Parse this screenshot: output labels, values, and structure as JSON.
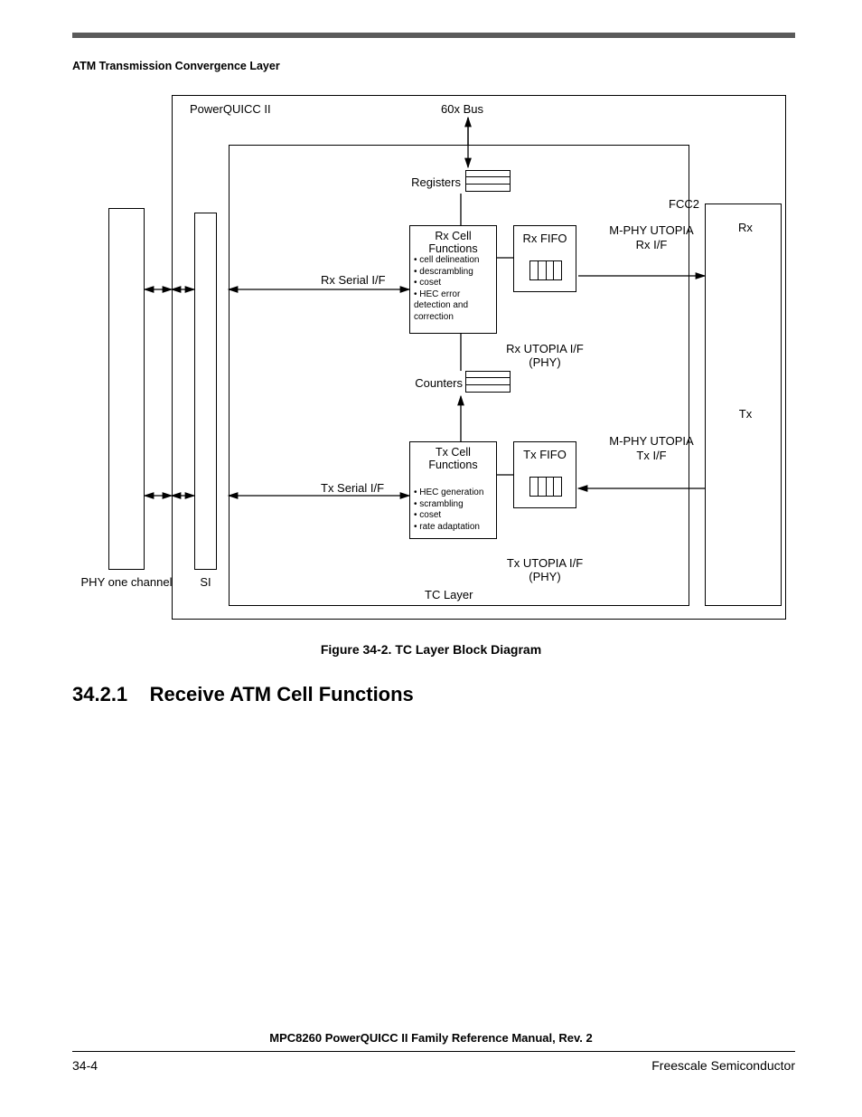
{
  "header": {
    "running_title": "ATM Transmission Convergence Layer"
  },
  "diagram": {
    "outer_label": "PowerQUICC II",
    "bus_label": "60x Bus",
    "registers_label": "Registers",
    "counters_label": "Counters",
    "rx_cell_title": "Rx Cell Functions",
    "rx_cell_bullets": {
      "b1": "• cell delineation",
      "b2": "• descrambling",
      "b3": "• coset",
      "b4": "• HEC error detection and correction"
    },
    "tx_cell_title": "Tx Cell Functions",
    "tx_cell_bullets": {
      "b1": "• HEC generation",
      "b2": "• scrambling",
      "b3": "• coset",
      "b4": "• rate adaptation"
    },
    "rx_fifo": "Rx FIFO",
    "tx_fifo": "Tx FIFO",
    "rx_serial_if": "Rx Serial I/F",
    "tx_serial_if": "Tx Serial I/F",
    "rx_utopia": "Rx UTOPIA I/F (PHY)",
    "tx_utopia": "Tx UTOPIA I/F (PHY)",
    "rx_mphy": "M-PHY UTOPIA Rx I/F",
    "tx_mphy": "M-PHY UTOPIA Tx I/F",
    "fcc2_label": "FCC2",
    "fcc2_rx": "Rx",
    "fcc2_tx": "Tx",
    "phy_label": "PHY one channel",
    "si_label": "SI",
    "tclayer_label": "TC Layer"
  },
  "caption": "Figure 34-2. TC Layer Block Diagram",
  "section": {
    "number": "34.2.1",
    "title": "Receive ATM Cell Functions"
  },
  "footer": {
    "manual": "MPC8260 PowerQUICC II Family Reference Manual, Rev. 2",
    "page": "34-4",
    "vendor": "Freescale Semiconductor"
  }
}
